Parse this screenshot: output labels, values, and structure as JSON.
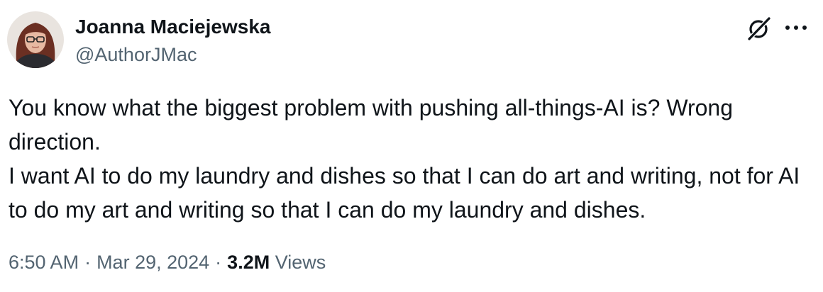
{
  "author": {
    "display_name": "Joanna Maciejewska",
    "handle": "@AuthorJMac"
  },
  "icons": {
    "grok": "grok-icon",
    "more": "more-options-icon"
  },
  "tweet": {
    "text_line_1": "You know what the biggest problem with pushing all-things-AI is? Wrong direction.",
    "text_line_2": "I want AI to do my laundry and dishes so that I can do art and writing, not for AI to do my art and writing so that I can do my laundry and dishes."
  },
  "meta": {
    "time": "6:50 AM",
    "separator": "·",
    "date": "Mar 29, 2024",
    "views_count": "3.2M",
    "views_label": "Views"
  },
  "colors": {
    "text_primary": "#0f1419",
    "text_secondary": "#536471"
  }
}
